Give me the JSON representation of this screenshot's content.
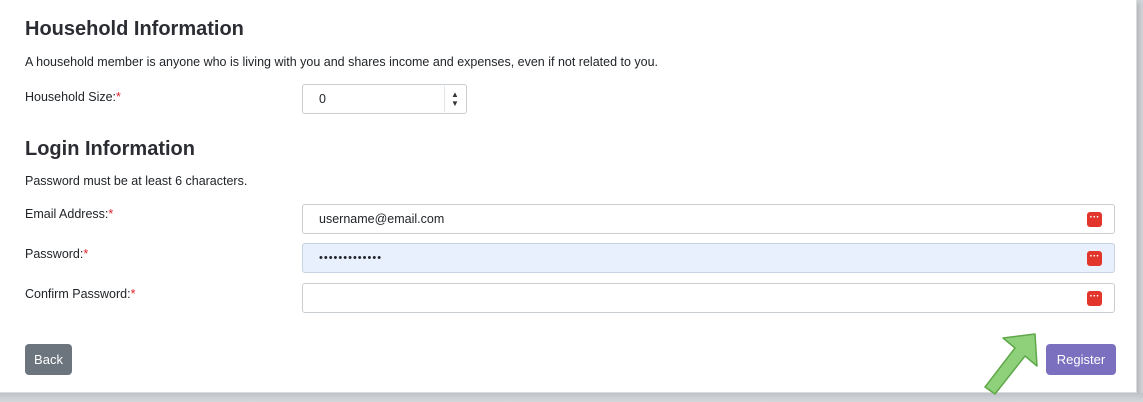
{
  "household": {
    "title": "Household Information",
    "description": "A household member is anyone who is living with you and shares income and expenses, even if not related to you.",
    "size_label": "Household Size:",
    "size_value": "0"
  },
  "login": {
    "title": "Login Information",
    "hint": "Password must be at least 6 characters.",
    "email_label": "Email Address:",
    "email_value": "username@email.com",
    "password_label": "Password:",
    "password_value": "•••••••••••••",
    "confirm_label": "Confirm Password:",
    "confirm_value": ""
  },
  "required_mark": "*",
  "buttons": {
    "back": "Back",
    "register": "Register"
  },
  "icons": {
    "password_manager": "password-manager-icon",
    "arrow": "arrow-pointer-icon"
  },
  "colors": {
    "required": "#d9232d",
    "back_button": "#6c757d",
    "register_button": "#7b6fc0",
    "autofill_bg": "#e8f0fe",
    "password_manager_icon": "#e2362c",
    "arrow": "#8fd07a"
  }
}
